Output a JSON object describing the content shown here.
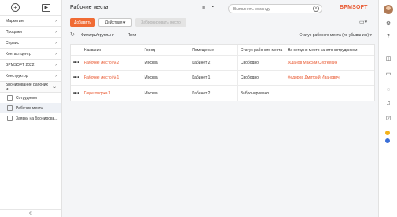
{
  "sidebar": {
    "menu": [
      {
        "label": "Маркетинг"
      },
      {
        "label": "Продажи"
      },
      {
        "label": "Сервис"
      },
      {
        "label": "Контакт центр"
      },
      {
        "label": "BPMSOFT 2022"
      },
      {
        "label": "Конструктор"
      },
      {
        "label": "Бронирование рабочих м..."
      }
    ],
    "subitems": [
      {
        "label": "Сотрудники"
      },
      {
        "label": "Рабочие места"
      },
      {
        "label": "Заявки на бронирова..."
      }
    ],
    "collapse_glyph": "«"
  },
  "header": {
    "title": "Рабочие места",
    "search_placeholder": "Выполнить команду",
    "logo": "BPMSOFT"
  },
  "actions": {
    "add_label": "Добавить",
    "actions_label": "Действия ▾",
    "book_label": "Забронировать место"
  },
  "toolbar": {
    "filters_label": "Фильтры/группы ▾",
    "tags_label": "Теги",
    "sort_label": "Статус рабочего места (по убыванию) ▾"
  },
  "table": {
    "columns": [
      "Название",
      "Город",
      "Помещение",
      "Статус рабочего места",
      "На сегодня место занято сотрудником"
    ],
    "rows": [
      {
        "name": "Рабочее место №2",
        "city": "Москва",
        "room": "Кабинет 2",
        "status": "Свободно",
        "employee": "Жданов Максим Сергеевич"
      },
      {
        "name": "Рабочее место №1",
        "city": "Москва",
        "room": "Кабинет 1",
        "status": "Свободно",
        "employee": "Федоров Дмитрий Иванович"
      },
      {
        "name": "Переговорка 1",
        "city": "Москва",
        "room": "Кабинет 2",
        "status": "Забронировано",
        "employee": ""
      }
    ]
  },
  "colors": {
    "accent": "#f06b34",
    "link": "#e8572f"
  }
}
